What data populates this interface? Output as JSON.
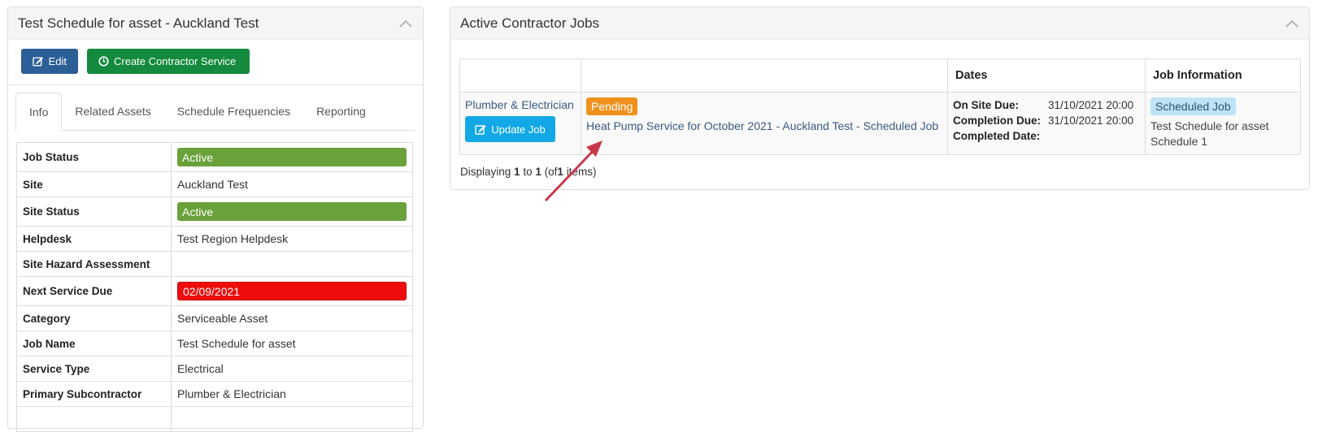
{
  "left_panel": {
    "title": "Test Schedule for asset - Auckland Test",
    "buttons": {
      "edit": "Edit",
      "create": "Create Contractor Service"
    },
    "tabs": [
      "Info",
      "Related Assets",
      "Schedule Frequencies",
      "Reporting"
    ],
    "active_tab": "Info",
    "rows": {
      "job_status": {
        "label": "Job Status",
        "value": "Active"
      },
      "site": {
        "label": "Site",
        "value": "Auckland Test"
      },
      "site_status": {
        "label": "Site Status",
        "value": "Active"
      },
      "helpdesk": {
        "label": "Helpdesk",
        "value": "Test Region Helpdesk"
      },
      "site_hazard": {
        "label": "Site Hazard Assessment",
        "value": ""
      },
      "next_service": {
        "label": "Next Service Due",
        "value": "02/09/2021"
      },
      "category": {
        "label": "Category",
        "value": "Serviceable Asset"
      },
      "job_name": {
        "label": "Job Name",
        "value": "Test Schedule for asset"
      },
      "service_type": {
        "label": "Service Type",
        "value": "Electrical"
      },
      "primary_sub": {
        "label": "Primary Subcontractor",
        "value": "Plumber & Electrician"
      }
    }
  },
  "right_panel": {
    "title": "Active Contractor Jobs",
    "headers": {
      "col1": "",
      "col2": "",
      "dates": "Dates",
      "job_info": "Job Information"
    },
    "job": {
      "contractor": "Plumber & Electrician",
      "update_button": "Update Job",
      "status": "Pending",
      "description": "Heat Pump Service for October 2021 - Auckland Test - Scheduled Job",
      "dates": {
        "on_site_label": "On Site Due:",
        "on_site_value": "31/10/2021 20:00",
        "completion_label": "Completion Due:",
        "completion_value": "31/10/2021 20:00",
        "completed_label": "Completed Date:",
        "completed_value": ""
      },
      "info_badge": "Scheduled Job",
      "info_text": "Test Schedule for asset Schedule 1"
    },
    "footer": {
      "prefix": "Displaying",
      "from": "1",
      "to_word": "to",
      "to": "1",
      "of_open": "(of",
      "total": "1",
      "suffix": "items)"
    }
  },
  "colors": {
    "active_green": "#6aa13a",
    "overdue_red": "#ee0d0d",
    "pending_orange": "#f0911d",
    "edit_blue": "#2c5f96",
    "create_green": "#138a3d",
    "update_blue": "#12a8e6",
    "annotation_arrow": "#c8384a"
  },
  "icons": {
    "collapse": "chevron-up-icon",
    "edit": "pencil-square-icon",
    "create": "clock-icon",
    "update": "pencil-square-icon"
  }
}
